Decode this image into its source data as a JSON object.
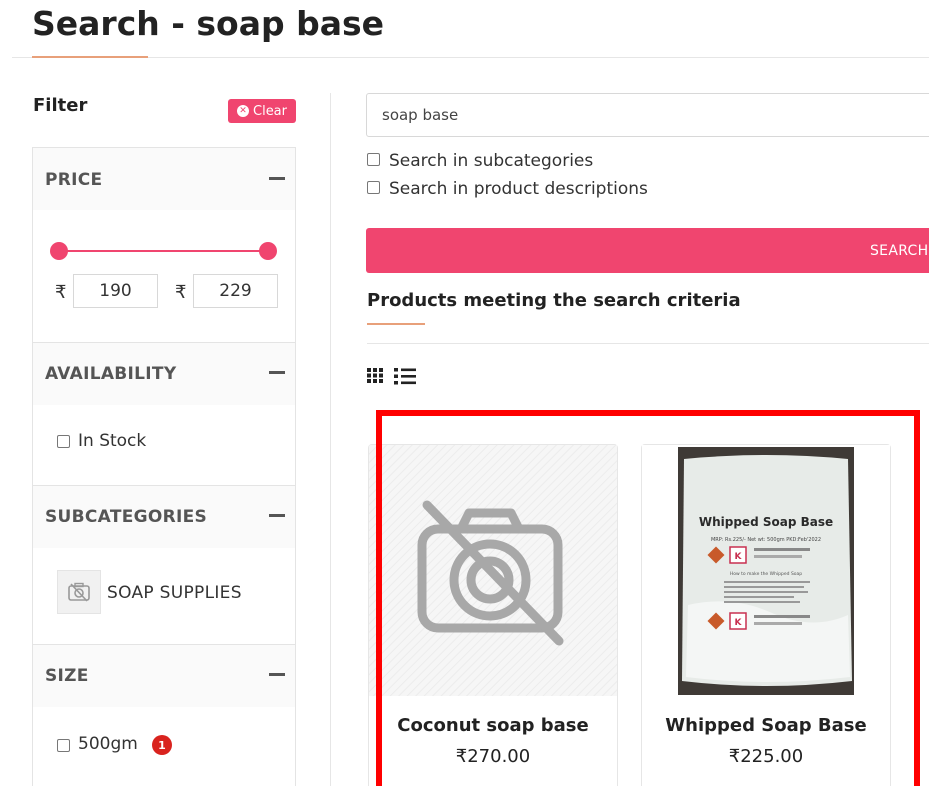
{
  "page": {
    "title": "Search - soap base"
  },
  "filter": {
    "label": "Filter",
    "clear_label": "Clear",
    "clear_icon": "x-circle-icon",
    "price": {
      "title": "PRICE",
      "currency": "₹",
      "min": "190",
      "max": "229",
      "slider_low_fraction": 0,
      "slider_high_fraction": 1
    },
    "availability": {
      "title": "AVAILABILITY",
      "options": [
        "In Stock"
      ]
    },
    "subcategories": {
      "title": "SUBCATEGORIES",
      "items": [
        "SOAP SUPPLIES"
      ]
    },
    "size": {
      "title": "SIZE",
      "options": [
        {
          "label": "500gm",
          "count": "1"
        }
      ]
    }
  },
  "search": {
    "value": "soap base",
    "options": [
      "Search in subcategories",
      "Search in product descriptions"
    ],
    "button_label": "SEARCH"
  },
  "results": {
    "title": "Products meeting the search criteria",
    "view_icons": [
      "grid-view-icon",
      "list-view-icon"
    ],
    "products": [
      {
        "name": "Coconut soap base",
        "price": "₹270.00",
        "image": "no-image-placeholder"
      },
      {
        "name": "Whipped Soap Base",
        "price": "₹225.00",
        "image": "product-photo",
        "package_label": "Whipped Soap Base",
        "package_mrp": "MRP: Rs.225/-   Net wt: 500gm   PKD:Feb'2022",
        "package_howto": "How to make the Whipped Soap"
      }
    ]
  },
  "colors": {
    "accent": "#f0456f",
    "underline": "#e8a07a",
    "highlight_border": "#ff0000",
    "badge": "#d9231e"
  }
}
